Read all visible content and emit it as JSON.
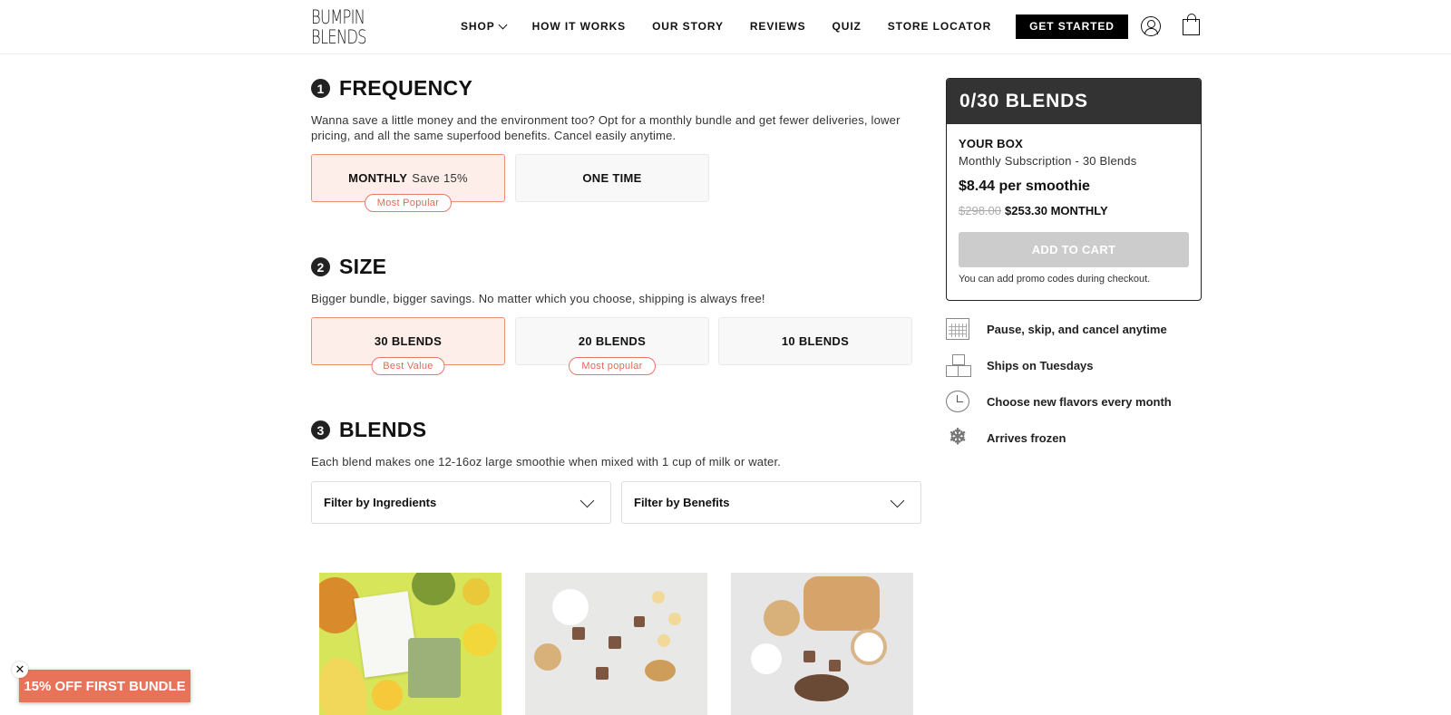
{
  "header": {
    "logo_line1": "BUMPIN",
    "logo_line2": "BLENDS",
    "nav": [
      "SHOP",
      "HOW IT WORKS",
      "OUR STORY",
      "REVIEWS",
      "QUIZ",
      "STORE LOCATOR"
    ],
    "cta": "GET STARTED",
    "icons": [
      "account-icon",
      "bag-icon"
    ]
  },
  "frequency": {
    "number": "1",
    "title": "FREQUENCY",
    "description": "Wanna save a little money and the environment too? Opt for a monthly bundle and get fewer deliveries, lower pricing, and all the same superfood benefits. Cancel easily anytime.",
    "monthly_label": "MONTHLY",
    "monthly_save": "Save 15%",
    "monthly_badge": "Most Popular",
    "one_time_label": "ONE TIME"
  },
  "size": {
    "number": "2",
    "title": "SIZE",
    "description": "Bigger bundle, bigger savings. No matter which you choose, shipping is always free!",
    "options": [
      {
        "label": "30 BLENDS",
        "badge": "Best Value"
      },
      {
        "label": "20 BLENDS",
        "badge": "Most popular"
      },
      {
        "label": "10 BLENDS",
        "badge": ""
      }
    ]
  },
  "blends": {
    "number": "3",
    "title": "BLENDS",
    "description": "Each blend makes one 12-16oz large smoothie when mixed with 1 cup of milk or water.",
    "filter_ingredients": "Filter by Ingredients",
    "filter_benefits": "Filter by Benefits"
  },
  "box": {
    "header": "0/30 BLENDS",
    "your_box": "YOUR BOX",
    "subscription": "Monthly Subscription - 30 Blends",
    "per_smoothie": "$8.44 per smoothie",
    "original_price": "$298.00",
    "price": "$253.30 MONTHLY",
    "add_to_cart": "ADD TO CART",
    "promo_note": "You can add promo codes during checkout."
  },
  "features": [
    {
      "icon": "calendar-icon",
      "label": "Pause, skip, and cancel anytime"
    },
    {
      "icon": "boxes-icon",
      "label": "Ships on Tuesdays"
    },
    {
      "icon": "clock-icon",
      "label": "Choose new flavors every month"
    },
    {
      "icon": "snowflake-icon",
      "label": "Arrives frozen"
    }
  ],
  "promo_badge": "15% OFF FIRST BUNDLE",
  "colors": {
    "accent": "#e97358",
    "selected_bg": "#fdeee9",
    "dark": "#333333"
  }
}
